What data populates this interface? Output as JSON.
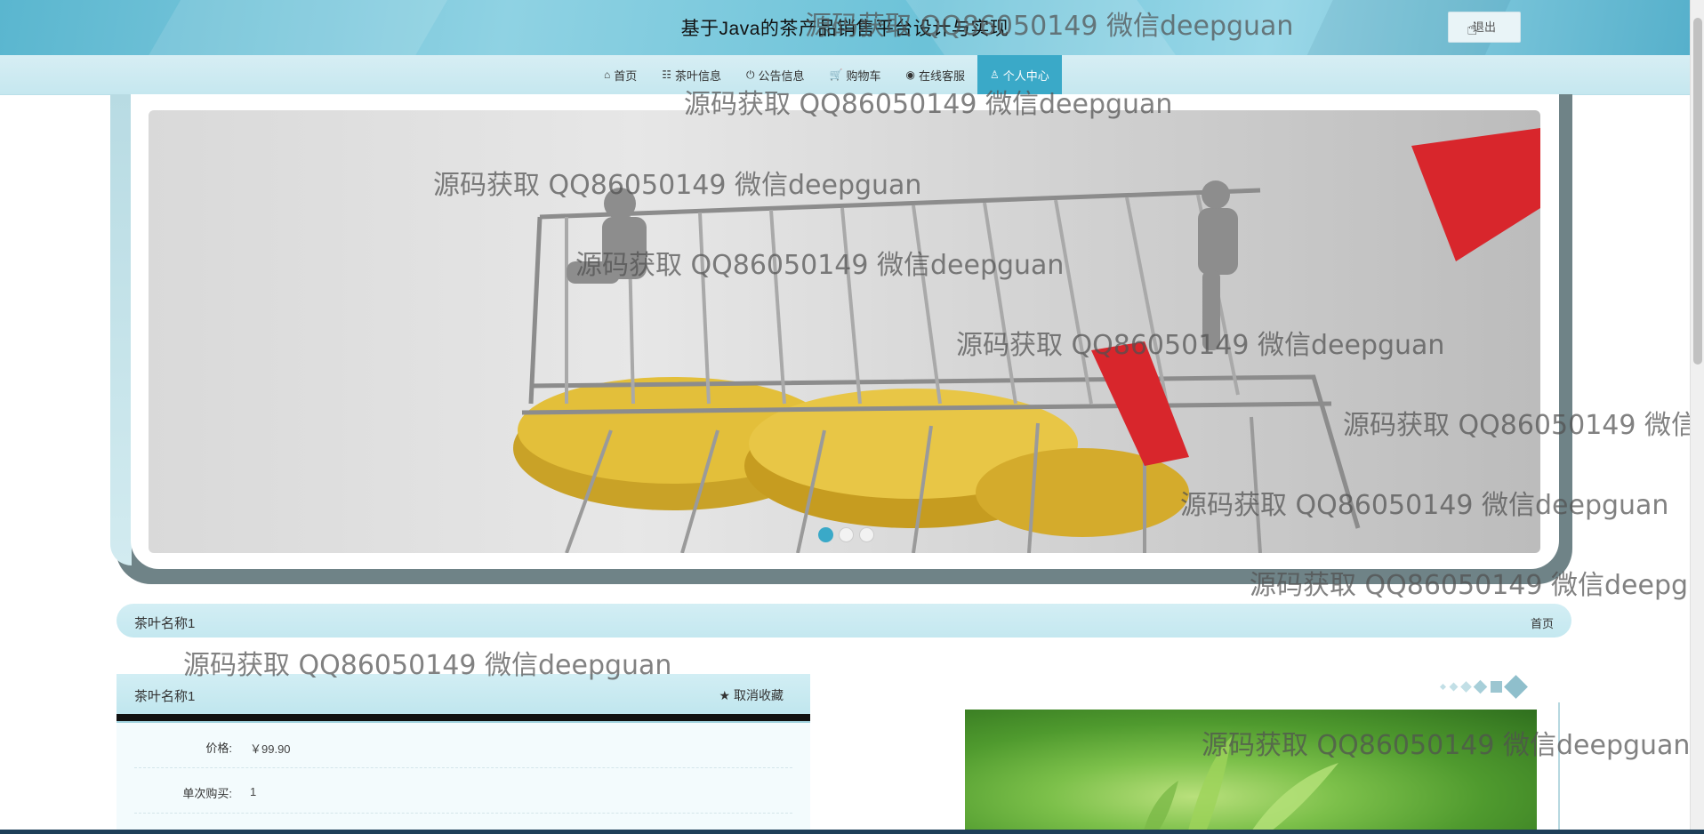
{
  "header": {
    "title": "基于Java的茶产品销售平台设计与实现",
    "logout_label": "退出"
  },
  "nav": {
    "items": [
      {
        "icon": "⌂",
        "label": "首页"
      },
      {
        "icon": "☷",
        "label": "茶叶信息"
      },
      {
        "icon": "⏻",
        "label": "公告信息"
      },
      {
        "icon": "🛒",
        "label": "购物车"
      },
      {
        "icon": "◉",
        "label": "在线客服"
      },
      {
        "icon": "♙",
        "label": "个人中心"
      }
    ],
    "active": "个人中心"
  },
  "banner": {
    "active_slide": 1,
    "slide_count": 3
  },
  "breadcrumb": {
    "title": "茶叶名称1",
    "home": "首页"
  },
  "detail": {
    "title": "茶叶名称1",
    "favorite_label": "取消收藏",
    "fields": [
      {
        "label": "价格:",
        "value": "￥99.90"
      },
      {
        "label": "单次购买:",
        "value": "1"
      }
    ]
  },
  "watermark": "源码获取 QQ86050149 微信deepguan",
  "colors": {
    "accent": "#3aa9c8",
    "header": "#6cc2d8"
  }
}
